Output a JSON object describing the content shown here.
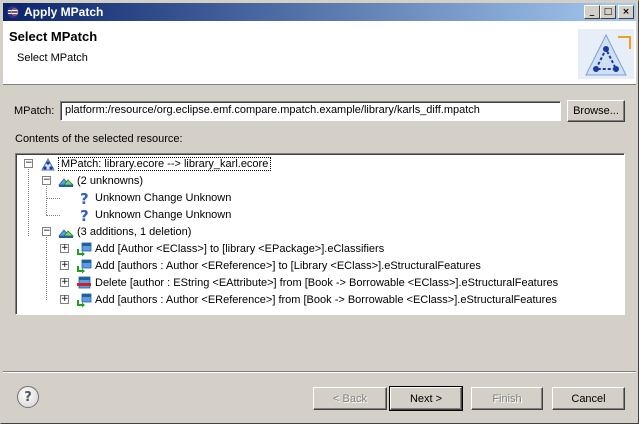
{
  "window": {
    "title": "Apply MPatch",
    "minimize_glyph": "_",
    "maximize_glyph": "□",
    "close_glyph": "×"
  },
  "header": {
    "title": "Select MPatch",
    "subtitle": "Select MPatch"
  },
  "form": {
    "mpatch_label": "MPatch:",
    "mpatch_value": "platform:/resource/org.eclipse.emf.compare.mpatch.example/library/karls_diff.mpatch",
    "browse_label": "Browse...",
    "contents_label": "Contents of the selected resource:"
  },
  "tree": {
    "root": "MPatch:   library.ecore   -->   library_karl.ecore",
    "group1": "(2 unknowns)",
    "unknown1": "Unknown Change Unknown",
    "unknown2": "Unknown Change Unknown",
    "group2": "(3 additions, 1 deletion)",
    "change1": "Add [Author <EClass>] to [library <EPackage>].eClassifiers",
    "change2": "Add [authors : Author <EReference>] to [Library <EClass>].eStructuralFeatures",
    "change3": "Delete [author : EString <EAttribute>] from [Book -> Borrowable <EClass>].eStructuralFeatures",
    "change4": "Add [authors : Author <EReference>] from [Book -> Borrowable <EClass>].eStructuralFeatures",
    "expand_glyph": "+",
    "collapse_glyph": "−"
  },
  "footer": {
    "help_glyph": "?",
    "back_label": "< Back",
    "next_label": "Next >",
    "finish_label": "Finish",
    "cancel_label": "Cancel"
  },
  "colors": {
    "title_start": "#0a246a",
    "title_end": "#a6caf0",
    "face": "#d4d0c8"
  }
}
